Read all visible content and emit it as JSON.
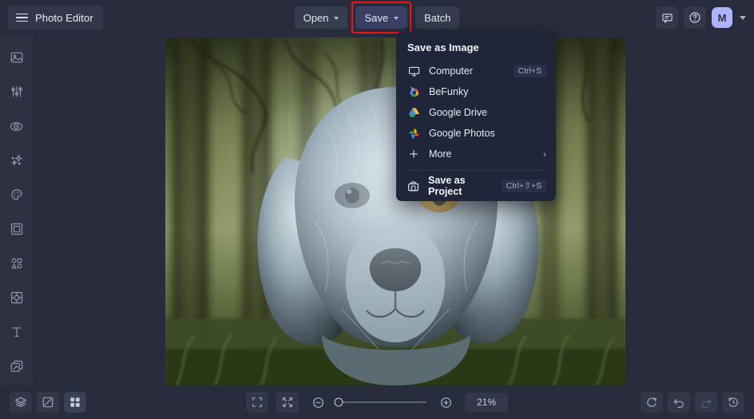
{
  "app": {
    "brand_label": "Photo Editor",
    "hamburger_icon": "hamburger-menu-icon"
  },
  "toolbar": {
    "open_label": "Open",
    "save_label": "Save",
    "batch_label": "Batch",
    "save_highlight_color": "#f01414",
    "save_button_color": "#3b3f63"
  },
  "topright": {
    "feedback_icon": "chat-bubble-icon",
    "help_icon": "question-circle-icon",
    "avatar_initial": "M",
    "avatar_color": "#aeb4fa"
  },
  "sidebar": {
    "items": [
      {
        "name": "edit-photo",
        "icon": "image-icon"
      },
      {
        "name": "adjust",
        "icon": "sliders-icon"
      },
      {
        "name": "retouch",
        "icon": "eye-icon"
      },
      {
        "name": "effects",
        "icon": "sparkles-icon"
      },
      {
        "name": "artsy",
        "icon": "palette-icon"
      },
      {
        "name": "frames",
        "icon": "frame-icon"
      },
      {
        "name": "graphics",
        "icon": "shapes-icon"
      },
      {
        "name": "overlays",
        "icon": "overlay-icon"
      },
      {
        "name": "text",
        "icon": "text-t-icon"
      },
      {
        "name": "layers",
        "icon": "layers-stack-icon"
      }
    ]
  },
  "menu": {
    "title": "Save as Image",
    "items": [
      {
        "label": "Computer",
        "icon": "monitor-icon",
        "shortcut": "Ctrl+S"
      },
      {
        "label": "BeFunky",
        "icon": "befunky-logo-icon",
        "shortcut": ""
      },
      {
        "label": "Google Drive",
        "icon": "google-drive-icon",
        "shortcut": ""
      },
      {
        "label": "Google Photos",
        "icon": "google-photos-icon",
        "shortcut": ""
      },
      {
        "label": "More",
        "icon": "plus-icon",
        "shortcut": "",
        "arrow": "›"
      }
    ],
    "project": {
      "label": "Save as Project",
      "icon": "project-save-icon",
      "shortcut": "Ctrl+⇧+S"
    }
  },
  "bottombar": {
    "left": [
      {
        "name": "layers-panel",
        "icon": "layers-icon",
        "active": false
      },
      {
        "name": "transparency",
        "icon": "transparency-icon",
        "active": false
      },
      {
        "name": "grid-view",
        "icon": "grid-icon",
        "active": true
      }
    ],
    "center": {
      "fit_screen_icon": "fit-to-screen-icon",
      "actual_size_icon": "actual-size-icon",
      "zoom_out_icon": "zoom-out-icon",
      "zoom_in_icon": "zoom-in-icon",
      "zoom_level": "21%",
      "slider_position_pct": 2
    },
    "right": [
      {
        "name": "reset",
        "icon": "reset-icon",
        "dim": false
      },
      {
        "name": "undo",
        "icon": "undo-icon",
        "dim": false
      },
      {
        "name": "redo",
        "icon": "redo-icon",
        "dim": true
      },
      {
        "name": "history",
        "icon": "history-icon",
        "dim": false
      }
    ]
  },
  "canvas": {
    "image_description": "Blue-grey long-haired dog portrait in misty green forest",
    "zoom_level": "21%"
  }
}
